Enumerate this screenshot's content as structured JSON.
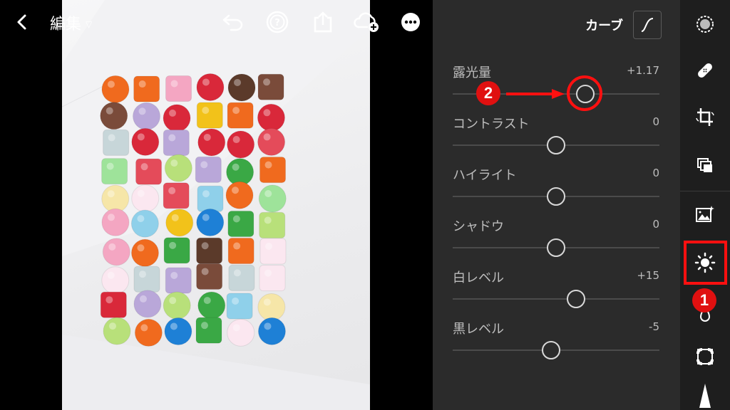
{
  "topbar": {
    "back_icon": "chevron-left-icon",
    "title": "編集",
    "icons": [
      "undo-icon",
      "help-icon",
      "share-icon",
      "cloud-add-icon",
      "more-icon"
    ]
  },
  "panel": {
    "curve_label": "カーブ",
    "sliders": [
      {
        "label": "露光量",
        "value": "+1.17",
        "position": 0.64
      },
      {
        "label": "コントラスト",
        "value": "0",
        "position": 0.5
      },
      {
        "label": "ハイライト",
        "value": "0",
        "position": 0.5
      },
      {
        "label": "シャドウ",
        "value": "0",
        "position": 0.5
      },
      {
        "label": "白レベル",
        "value": "+15",
        "position": 0.595
      },
      {
        "label": "黒レベル",
        "value": "-5",
        "position": 0.475
      }
    ]
  },
  "tools": [
    "selective-icon",
    "healing-icon",
    "crop-icon",
    "versions-icon",
    "presets-icon",
    "light-icon",
    "color-icon",
    "effects-icon",
    "detail-icon"
  ],
  "annotations": {
    "badge_1": "1",
    "badge_2": "2"
  },
  "colors": {
    "highlight": "#ff1010",
    "panel_bg": "#2b2b2b",
    "tool_bg": "#1e1e1e"
  }
}
